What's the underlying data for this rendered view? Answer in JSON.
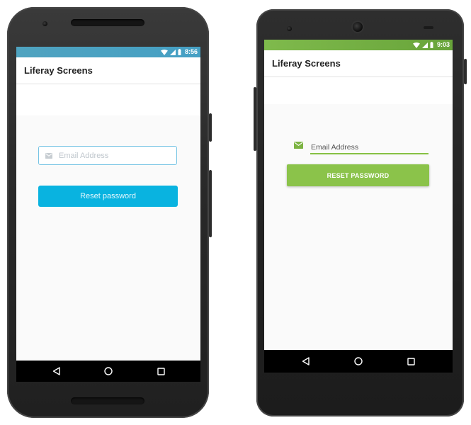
{
  "left_phone": {
    "status_bar": {
      "time": "8:56",
      "wifi_icon": "wifi-icon",
      "signal_icon": "signal-icon",
      "battery_icon": "battery-icon",
      "color": "#4fa3c0"
    },
    "app_bar": {
      "title": "Liferay Screens"
    },
    "form": {
      "email_placeholder": "Email Address",
      "email_value": "",
      "mail_icon": "mail-icon",
      "button_label": "Reset password",
      "accent_color": "#09b3e0"
    },
    "nav_bar": [
      "back-icon",
      "home-icon",
      "recents-icon"
    ]
  },
  "right_phone": {
    "status_bar": {
      "time": "9:03",
      "wifi_icon": "wifi-icon",
      "signal_icon": "signal-icon",
      "battery_icon": "battery-icon",
      "color": "#7fba4c"
    },
    "app_bar": {
      "title": "Liferay Screens"
    },
    "form": {
      "email_placeholder": "Email Address",
      "email_value": "",
      "mail_icon": "mail-icon",
      "button_label": "RESET PASSWORD",
      "accent_color": "#8bc34a"
    },
    "nav_bar": [
      "back-icon",
      "home-icon",
      "recents-icon"
    ]
  }
}
